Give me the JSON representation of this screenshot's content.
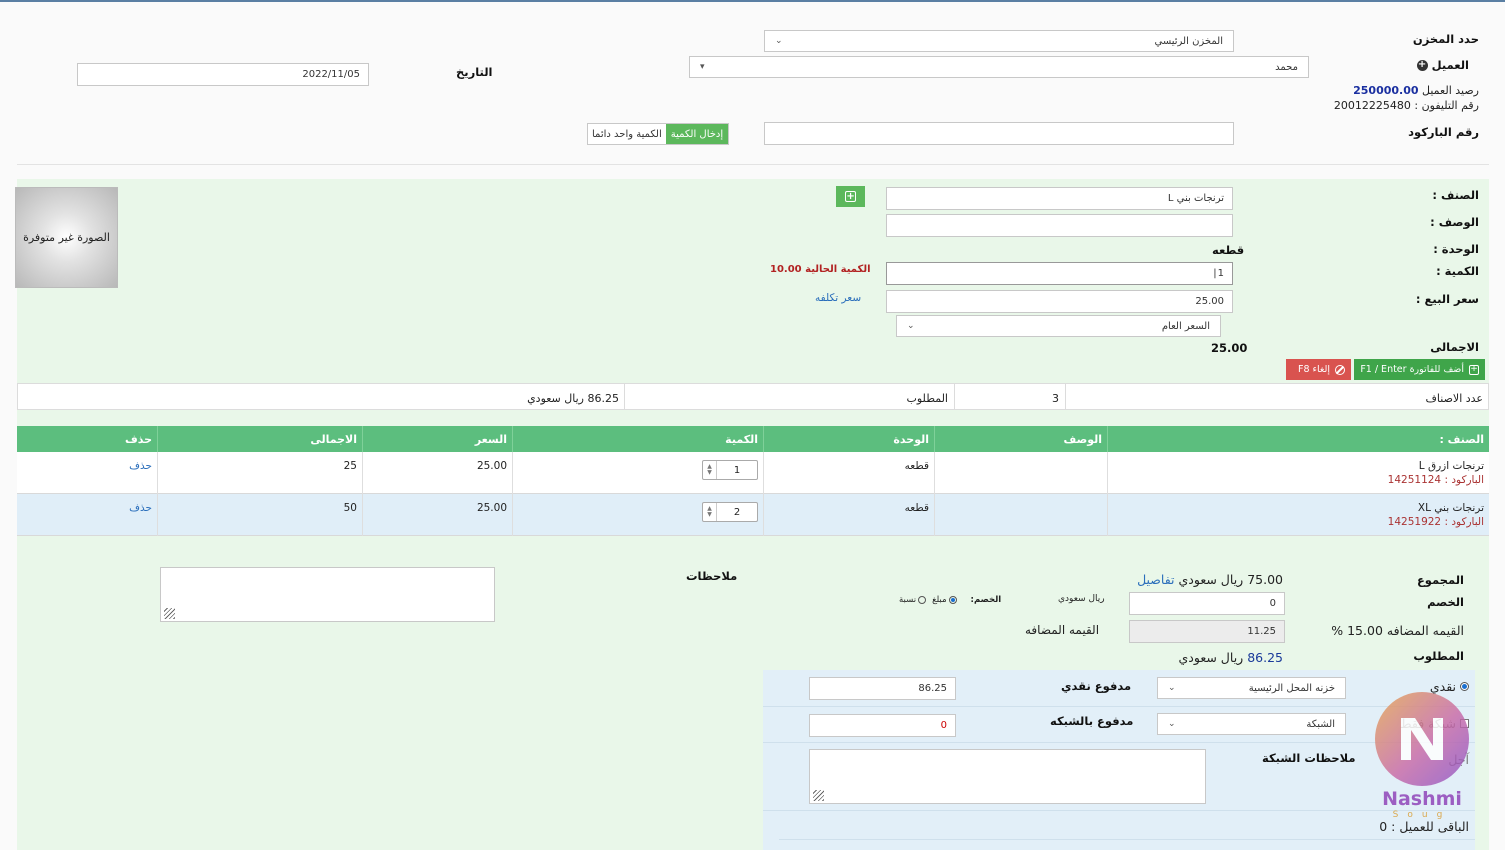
{
  "header": {
    "warehouse_label": "حدد المخزن",
    "warehouse_value": "المخزن الرئيسي",
    "customer_label": "العميل",
    "customer_value": "محمد",
    "date_label": "التاريخ",
    "date_value": "2022/11/05",
    "balance_label": "رصيد العميل",
    "balance_value": "250000.00",
    "phone_label": "رقم التليفون :",
    "phone_value": "20012225480",
    "barcode_label": "رقم الباركود",
    "barcode_value": "",
    "mode_enter_qty": "إدخال الكمية",
    "mode_qty_one": "الكمية واحد دائما"
  },
  "item": {
    "image_placeholder": "الصورة غير متوفرة",
    "class_label": "الصنف :",
    "class_value": "ترنجات بني L",
    "desc_label": "الوصف :",
    "desc_value": "",
    "unit_label": "الوحدة :",
    "unit_value": "قطعه",
    "qty_label": "الكمية :",
    "qty_value": "1",
    "current_qty_label": "الكمية الحالية",
    "current_qty_value": "10.00",
    "price_label": "سعر البيع :",
    "price_value": "25.00",
    "cost_link": "سعر تكلفه",
    "price_type": "السعر العام",
    "total_label": "الاجمالى",
    "total_value": "25.00",
    "add_btn": "أضف للفاتورة F1 / Enter",
    "cancel_btn": "إلغاء F8"
  },
  "summary": {
    "count_label": "عدد الاصناف",
    "count_value": "3",
    "required_label": "المطلوب",
    "required_value": "86.25 ريال سعودي"
  },
  "table": {
    "headers": [
      "الصنف :",
      "الوصف",
      "الوحدة",
      "الكمية",
      "السعر",
      "الاجمالى",
      "حذف"
    ],
    "barcode_prefix": "الباركود :",
    "rows": [
      {
        "name": "ترنجات ازرق L",
        "barcode": "14251124",
        "desc": "",
        "unit": "قطعه",
        "qty": "1",
        "price": "25.00",
        "total": "25",
        "delete": "حذف"
      },
      {
        "name": "ترنجات بني XL",
        "barcode": "14251922",
        "desc": "",
        "unit": "قطعه",
        "qty": "2",
        "price": "25.00",
        "total": "50",
        "delete": "حذف"
      }
    ]
  },
  "totals": {
    "sum_label": "المجموع",
    "sum_value": "75.00",
    "currency": "ريال سعودي",
    "details_link": "تفاصيل",
    "discount_label": "الخصم",
    "discount_value": "0",
    "discount_currency": "ريال سعودي",
    "discount_type_label": "الخصم:",
    "discount_opt_amount": "مبلغ",
    "discount_opt_percent": "نسبة",
    "vat_label": "القيمه المضافه 15.00 %",
    "vat_value": "11.25",
    "vat_suffix": "القيمه المضافه",
    "required_label": "المطلوب",
    "required_value": "86.25",
    "notes_label": "ملاحظات"
  },
  "payment": {
    "cash_label": "نقدي",
    "cash_box": "خزنه المحل الرئيسية",
    "cash_paid_label": "مدفوع نقدي",
    "cash_paid_value": "86.25",
    "network_label": "شبكة فقط",
    "network_box": "الشبكة",
    "network_paid_label": "مدفوع بالشبكه",
    "network_paid_value": "0",
    "deferred_label": "آجل",
    "network_notes_label": "ملاحظات الشبكة",
    "remaining_label": "الباقى للعميل :",
    "remaining_value": "0"
  },
  "watermark": {
    "brand": "Nashmi",
    "sub": "Soug"
  }
}
